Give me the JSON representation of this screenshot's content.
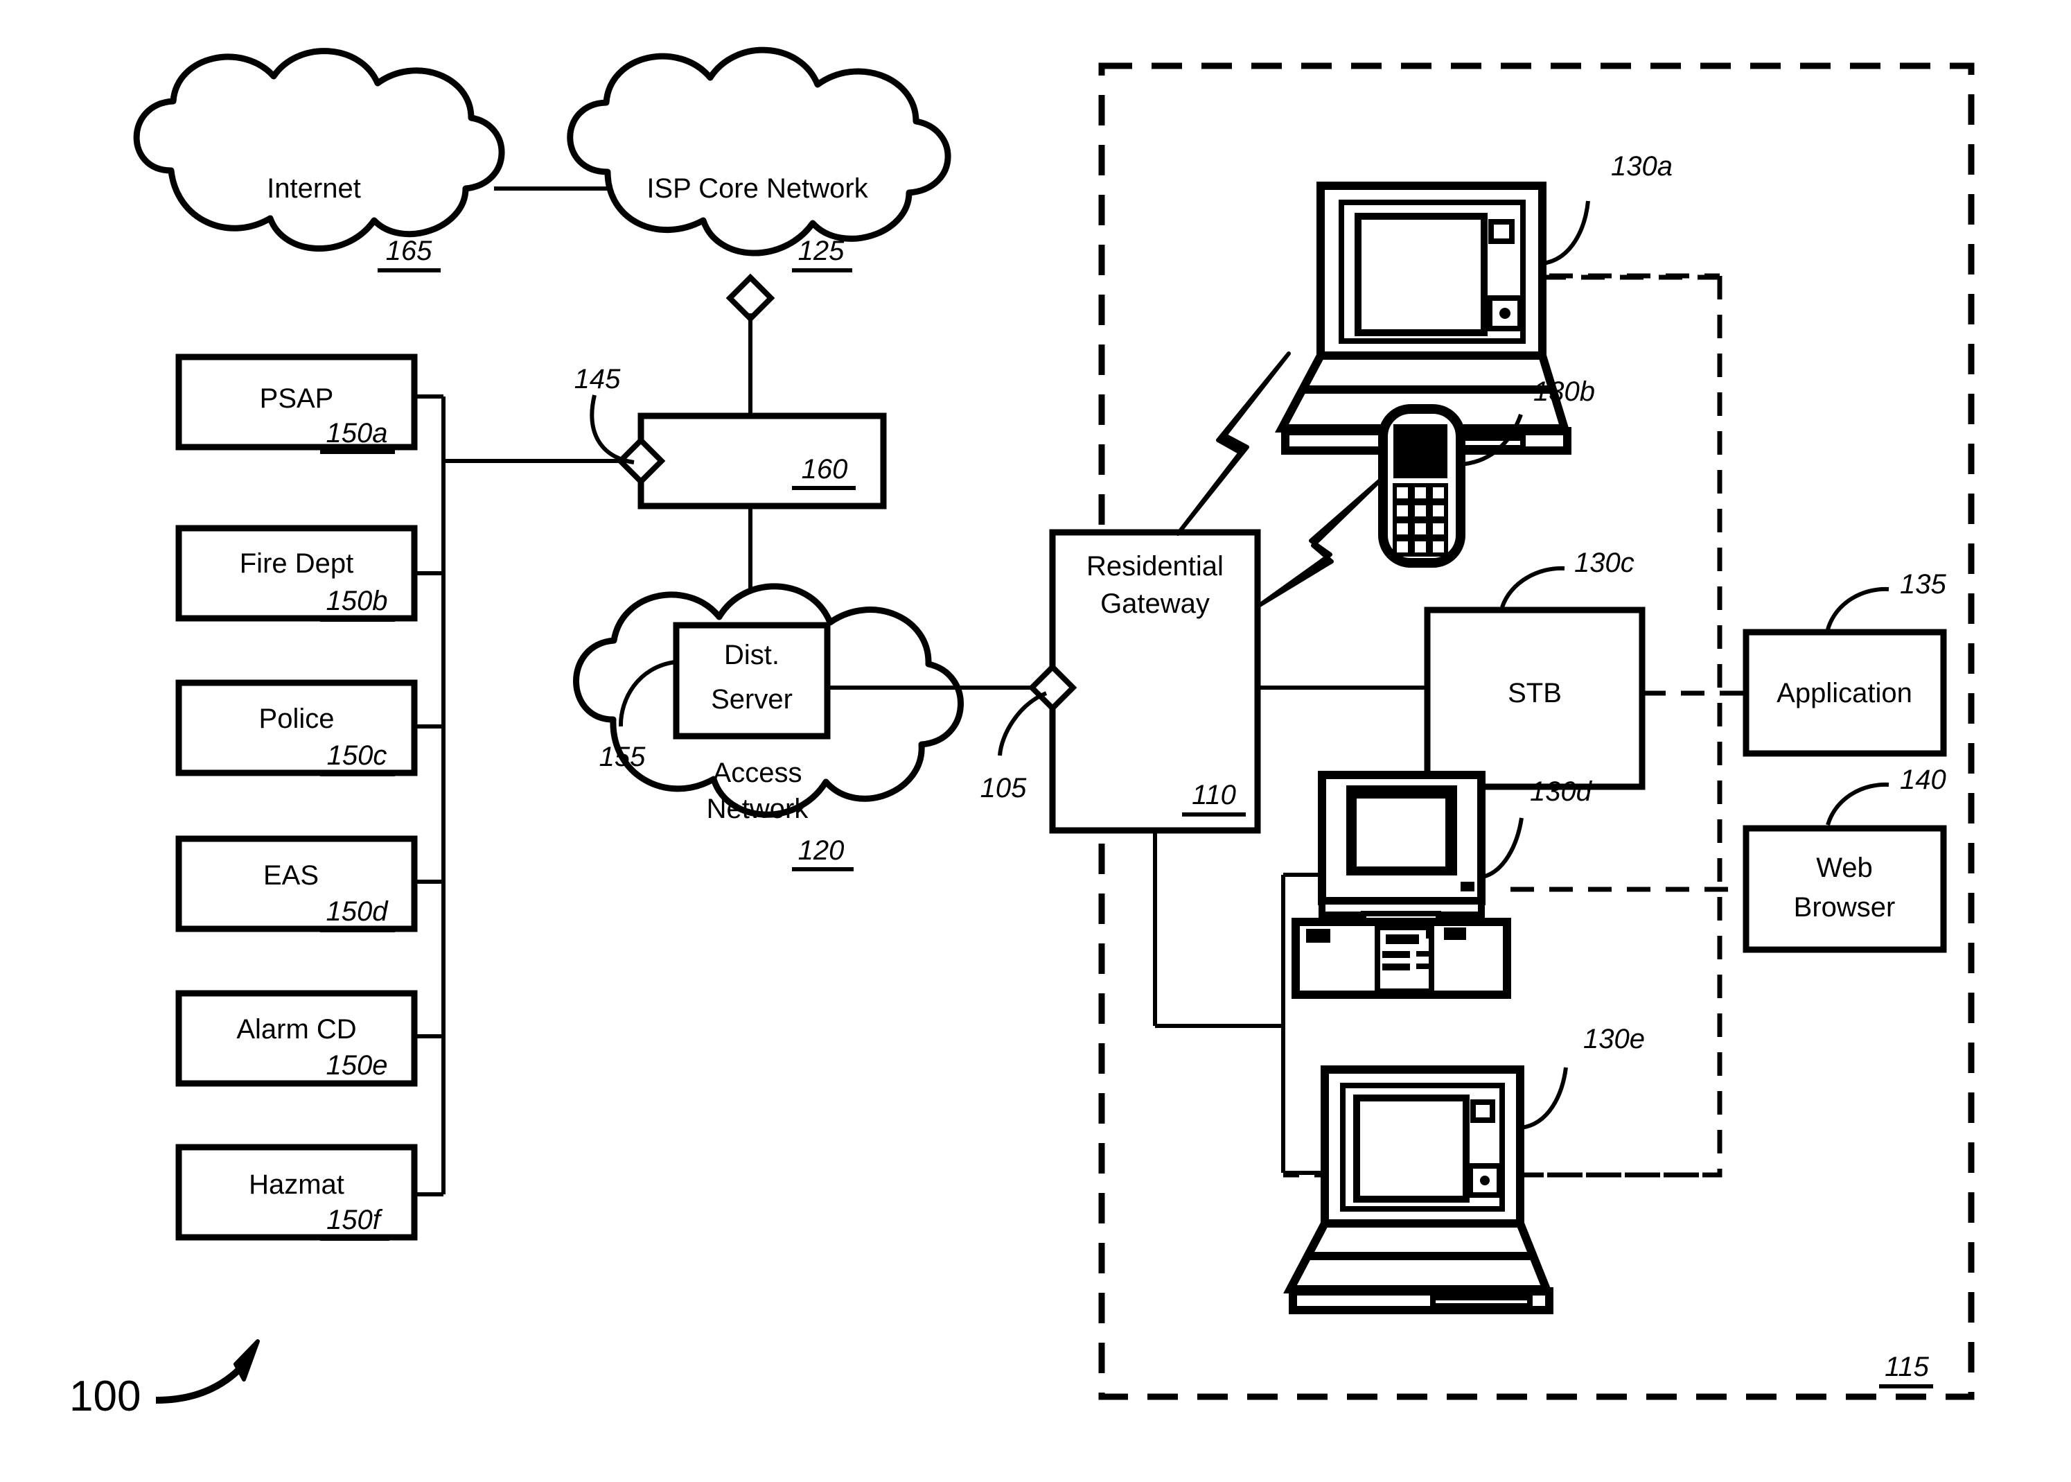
{
  "figure": {
    "number": "100",
    "clouds": [
      {
        "id": "internet",
        "label": "Internet",
        "ref": "165"
      },
      {
        "id": "isp-core",
        "label": "ISP Core Network",
        "ref": "125"
      },
      {
        "id": "access-network",
        "label_line1": "Access",
        "label_line2": "Network",
        "ref": "120",
        "inner_ref": "155"
      }
    ],
    "agency_boxes": [
      {
        "label": "PSAP",
        "ref": "150a"
      },
      {
        "label": "Fire Dept",
        "ref": "150b"
      },
      {
        "label": "Police",
        "ref": "150c"
      },
      {
        "label": "EAS",
        "ref": "150d"
      },
      {
        "label": "Alarm CD",
        "ref": "150e"
      },
      {
        "label": "Hazmat",
        "ref": "150f"
      }
    ],
    "boxes": [
      {
        "id": "node-160",
        "label": "",
        "ref": "160",
        "pointer_ref": "145"
      },
      {
        "id": "dist-server",
        "label_line1": "Dist.",
        "label_line2": "Server",
        "ref": ""
      },
      {
        "id": "residential-gateway",
        "label_line1": "Residential",
        "label_line2": "Gateway",
        "ref": "110",
        "pointer_ref": "105"
      },
      {
        "id": "stb",
        "label": "STB",
        "ref": "130c"
      },
      {
        "id": "application",
        "label": "Application",
        "ref": "135"
      },
      {
        "id": "web-browser",
        "label_line1": "Web",
        "label_line2": "Browser",
        "ref": "140"
      }
    ],
    "devices": [
      {
        "id": "laptop-top",
        "kind": "laptop",
        "ref": "130a"
      },
      {
        "id": "mobile-phone",
        "kind": "mobile-phone",
        "ref": "130b"
      },
      {
        "id": "desktop-pc",
        "kind": "desktop-pc",
        "ref": "130d"
      },
      {
        "id": "laptop-bottom",
        "kind": "laptop",
        "ref": "130e"
      }
    ],
    "premises_boundary_ref": "115",
    "colors": {
      "stroke": "#000000",
      "fill": "#ffffff"
    }
  }
}
